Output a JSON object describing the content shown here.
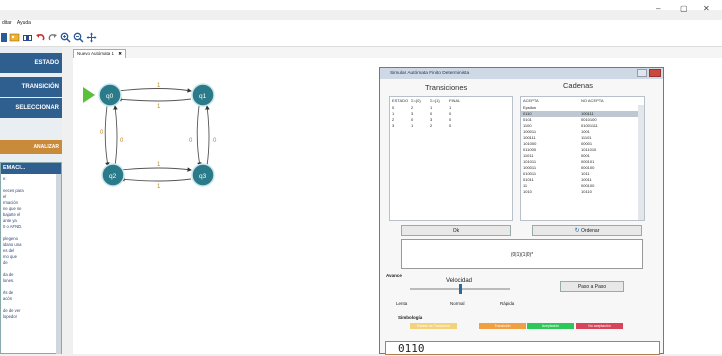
{
  "app": {
    "menu": [
      "ditar",
      "Ayuda"
    ],
    "window_controls": [
      "–",
      "▢",
      "✕"
    ],
    "tab_label": "Nuevo Autómata 1",
    "tab_close": "✖"
  },
  "left_panel": {
    "buttons": [
      "ESTADO",
      "TRANSICIÓN",
      "SELECCIONAR"
    ],
    "action_button": "ANALIZAR",
    "info_title": "EMACI...",
    "info_text": "e:\n\nneces para\nel\nrmación\nne que se\nbajarte el\nante ya\n0 o AFND.\n\nplegeno\nidano una\nes del\nmo que\nde\n\nda de\nlones.\n\nrls de\nacón\n\nde de ver\nlopedor"
  },
  "automaton": {
    "states": [
      {
        "id": "q0",
        "label": "q0",
        "initial": true
      },
      {
        "id": "q1",
        "label": "q1"
      },
      {
        "id": "q2",
        "label": "q2"
      },
      {
        "id": "q3",
        "label": "q3"
      }
    ],
    "edge_labels": {
      "q0_q1": "1",
      "q1_q0": "1",
      "q0_q2": "0",
      "q2_q0": "0",
      "q1_q3": "0",
      "q3_q1": "0",
      "q2_q3": "1",
      "q3_q2": "1"
    }
  },
  "dialog": {
    "title": "Simular Autómata Finito Determinista",
    "transitions_title": "Transiciones",
    "strings_title": "Cadenas",
    "transitions": {
      "headers": [
        "ESTADO",
        "Σ={0}",
        "Σ={1}",
        "FINAL"
      ],
      "rows": [
        [
          "0",
          "2",
          "1",
          "1"
        ],
        [
          "1",
          "3",
          "0",
          "0"
        ],
        [
          "2",
          "0",
          "3",
          "0"
        ],
        [
          "3",
          "1",
          "2",
          "0"
        ]
      ]
    },
    "strings": {
      "headers": [
        "ACEPTA",
        "NO ACEPTA"
      ],
      "rows": [
        [
          "Epsilon",
          ""
        ],
        [
          "0110",
          "100111"
        ],
        [
          "0101",
          "0010100"
        ],
        [
          "1100",
          "01001111"
        ],
        [
          "100011",
          "1001"
        ],
        [
          "100111",
          "11101"
        ],
        [
          "101000",
          "00001"
        ],
        [
          "011000",
          "1011010"
        ],
        [
          "11011",
          "0001"
        ],
        [
          "101011",
          "000101"
        ],
        [
          "100011",
          "000100"
        ],
        [
          "010011",
          "1011"
        ],
        [
          "01011",
          "10011"
        ],
        [
          "11",
          "000100"
        ],
        [
          "1010",
          "10110"
        ]
      ]
    },
    "ok_label": "Ok",
    "order_label": "Ordenar",
    "expression": "(0|1)(1|0)*",
    "speed_title": "Velocidad",
    "speed_section": "Avance",
    "speed_labels": [
      "Lenta",
      "Normal",
      "Rápida"
    ],
    "speed_value": 0.5,
    "step_button": "Paso a Paso",
    "legend_title": "Simbología",
    "legend": [
      {
        "label": "Estado de Transición",
        "color": "#f2d27a"
      },
      {
        "label": "Transición",
        "color": "#f0a040"
      },
      {
        "label": "Aceptación",
        "color": "#2ec85a"
      },
      {
        "label": "No aceptación",
        "color": "#d8445a"
      }
    ],
    "result": "0110"
  }
}
